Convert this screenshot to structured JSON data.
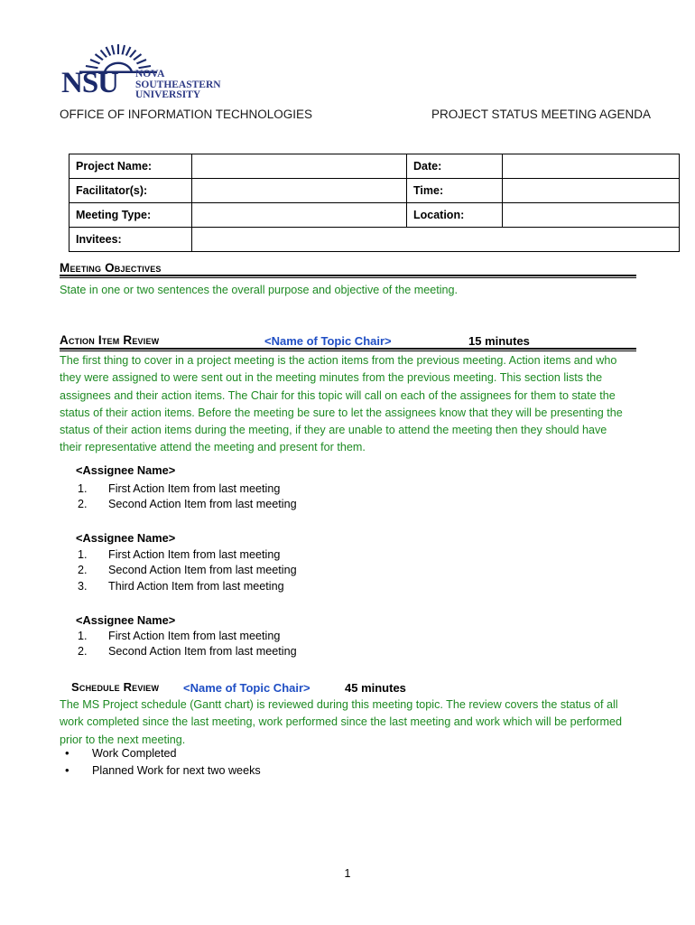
{
  "logo": {
    "acronym": "NSU",
    "line1": "NOVA",
    "line2": "SOUTHEASTERN",
    "line3": "UNIVERSITY",
    "icon": "sunburst-icon",
    "navy": "#1b2a6b"
  },
  "header": {
    "left_title": "OFFICE OF INFORMATION TECHNOLOGIES",
    "right_title": "PROJECT STATUS MEETING AGENDA"
  },
  "info_table": {
    "rows": [
      {
        "label_left": "Project Name:",
        "value_left": "",
        "label_right": "Date:",
        "value_right": ""
      },
      {
        "label_left": "Facilitator(s):",
        "value_left": "",
        "label_right": "Time:",
        "value_right": ""
      },
      {
        "label_left": "Meeting Type:",
        "value_left": "",
        "label_right": "Location:",
        "value_right": ""
      }
    ],
    "invitees_label": "Invitees:",
    "invitees_value": ""
  },
  "sections": {
    "meeting_objectives": {
      "heading": "Meeting Objectives",
      "body": "State in one or two sentences the overall purpose and objective of the meeting."
    },
    "action_item_review": {
      "heading": "Action Item Review",
      "chair": "<Name of Topic Chair>",
      "duration": "15 minutes",
      "body": "The first thing to cover in a project meeting is the action items from the previous meeting.  Action items and who they were assigned to were sent out in the meeting minutes from the previous meeting.  This section lists the assignees and their action items.  The Chair for this topic will call on each of the assignees for them to state the status of their action items.  Before the meeting be sure to let the assignees know that they will be presenting the status of their action items during the meeting, if they are unable to attend the meeting then they should have their representative attend the meeting and present for them.",
      "assignees": [
        {
          "name": "<Assignee Name>",
          "items": [
            {
              "mark": "1.",
              "text": "First Action Item from last meeting"
            },
            {
              "mark": "2.",
              "text": "Second Action Item from last meeting"
            }
          ]
        },
        {
          "name": "<Assignee Name>",
          "items": [
            {
              "mark": "1.",
              "text": "First Action Item from last meeting"
            },
            {
              "mark": "2.",
              "text": "Second Action Item from last meeting"
            },
            {
              "mark": "3.",
              "text": "Third Action Item from last meeting"
            }
          ]
        },
        {
          "name": "<Assignee Name>",
          "items": [
            {
              "mark": "1.",
              "text": "First Action Item from last meeting"
            },
            {
              "mark": "2.",
              "text": "Second Action Item from last meeting"
            }
          ]
        }
      ]
    },
    "schedule_review": {
      "heading": "Schedule Review",
      "chair": "<Name of Topic Chair>",
      "duration": "45 minutes",
      "body": "The MS Project schedule (Gantt chart) is reviewed during this meeting topic.  The review covers the status of all work completed since the last meeting, work performed since the last meeting and work which will be performed prior to the next meeting.",
      "bullets": [
        {
          "mark": "•",
          "text": "Work Completed"
        },
        {
          "mark": "•",
          "text": "Planned Work for next two weeks"
        }
      ]
    }
  },
  "footer": {
    "page_number": "1"
  },
  "colors": {
    "green_text": "#1d8a22",
    "blue_text": "#1f4ec4",
    "logo_navy": "#1b2a6b"
  }
}
